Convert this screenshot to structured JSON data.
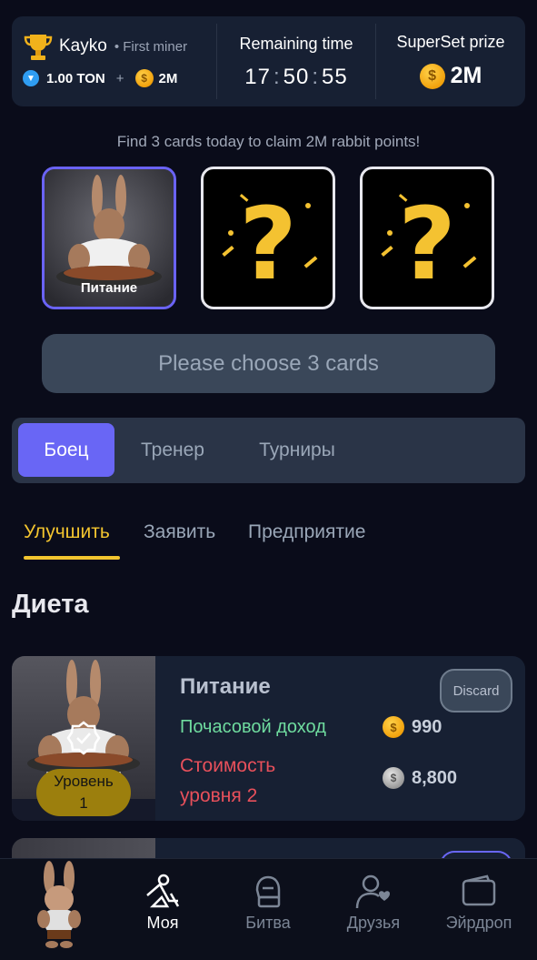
{
  "header": {
    "user_name": "Kayko",
    "user_tag": "• First miner",
    "ton_balance": "1.00 TON",
    "plus": "+",
    "coin_balance": "2M",
    "remaining_label": "Remaining time",
    "timer": {
      "h": "17",
      "m": "50",
      "s": "55",
      "sep": ":"
    },
    "prize_label": "SuperSet prize",
    "prize_value": "2M"
  },
  "notice": "Find 3 cards today to claim 2M rabbit points!",
  "cards": [
    {
      "label": "Питание",
      "state": "selected"
    },
    {
      "label": "",
      "state": "unknown"
    },
    {
      "label": "",
      "state": "unknown"
    }
  ],
  "choose_button": "Please choose 3 cards",
  "segments": {
    "active": "Боец",
    "items": [
      "Боец",
      "Тренер",
      "Турниры"
    ]
  },
  "subtabs": {
    "active": "Улучшить",
    "items": [
      "Улучшить",
      "Заявить",
      "Предприятие"
    ]
  },
  "section_title": "Диета",
  "item": {
    "name": "Питание",
    "discard_label": "Discard",
    "income_label": "Почасовой доход",
    "income_value": "990",
    "cost_label": "Стоимость уровня 2",
    "cost_value": "8,800",
    "level_label": "Уровень",
    "level_value": "1"
  },
  "nav": {
    "items": [
      {
        "label": "Моя",
        "icon": "miner-icon",
        "active": true
      },
      {
        "label": "Битва",
        "icon": "boxing-glove-icon",
        "active": false
      },
      {
        "label": "Друзья",
        "icon": "friends-icon",
        "active": false
      },
      {
        "label": "Эйрдроп",
        "icon": "wallet-icon",
        "active": false
      }
    ]
  },
  "colors": {
    "accent": "#6966f5",
    "gold": "#f3c52f",
    "income": "#6fdc9f",
    "cost": "#e8505b"
  }
}
